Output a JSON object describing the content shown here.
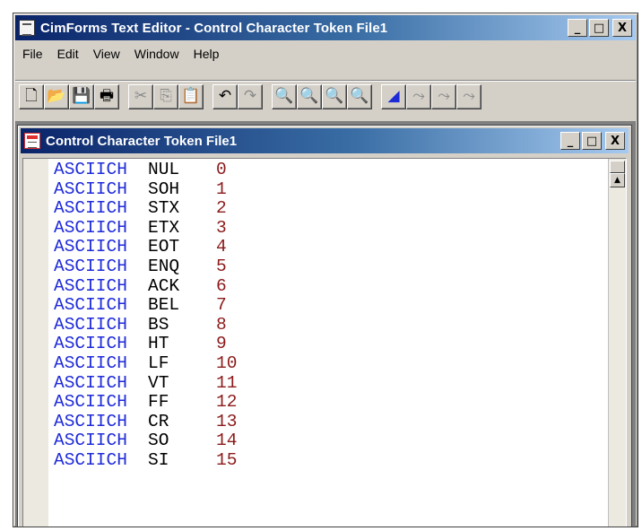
{
  "app": {
    "title": "CimForms Text Editor - Control Character Token File1",
    "window_buttons": {
      "minimize": "_",
      "maximize": "□",
      "close": "X"
    }
  },
  "menu": [
    "File",
    "Edit",
    "View",
    "Window",
    "Help"
  ],
  "toolbar": {
    "groups": [
      [
        {
          "name": "new-file-icon",
          "glyph": "🗋",
          "state": "enabled"
        },
        {
          "name": "open-folder-icon",
          "glyph": "📂",
          "state": "enabled"
        },
        {
          "name": "save-icon",
          "glyph": "💾",
          "state": "enabled"
        },
        {
          "name": "print-icon",
          "glyph": "🖶",
          "state": "enabled"
        }
      ],
      [
        {
          "name": "cut-icon",
          "glyph": "✂",
          "state": "disabled"
        },
        {
          "name": "copy-icon",
          "glyph": "⎘",
          "state": "disabled"
        },
        {
          "name": "paste-icon",
          "glyph": "📋",
          "state": "enabled"
        }
      ],
      [
        {
          "name": "undo-icon",
          "glyph": "↶",
          "state": "enabled"
        },
        {
          "name": "redo-icon",
          "glyph": "↷",
          "state": "disabled"
        }
      ],
      [
        {
          "name": "find-icon",
          "glyph": "🔍",
          "state": "enabled"
        },
        {
          "name": "find-next-icon",
          "glyph": "🔍",
          "state": "disabled"
        },
        {
          "name": "find-previous-icon",
          "glyph": "🔍",
          "state": "disabled"
        },
        {
          "name": "replace-icon",
          "glyph": "🔍",
          "state": "red"
        }
      ],
      [
        {
          "name": "bookmark-toggle-icon",
          "glyph": "◢",
          "state": "blue"
        },
        {
          "name": "bookmark-next-icon",
          "glyph": "⤳",
          "state": "disabled"
        },
        {
          "name": "bookmark-previous-icon",
          "glyph": "⤳",
          "state": "disabled"
        },
        {
          "name": "bookmark-clear-icon",
          "glyph": "⤳",
          "state": "disabled"
        }
      ]
    ]
  },
  "document": {
    "title": "Control Character Token File1",
    "lines": [
      {
        "keyword": "ASCIICH",
        "name": "NUL",
        "code": "0"
      },
      {
        "keyword": "ASCIICH",
        "name": "SOH",
        "code": "1"
      },
      {
        "keyword": "ASCIICH",
        "name": "STX",
        "code": "2"
      },
      {
        "keyword": "ASCIICH",
        "name": "ETX",
        "code": "3"
      },
      {
        "keyword": "ASCIICH",
        "name": "EOT",
        "code": "4"
      },
      {
        "keyword": "ASCIICH",
        "name": "ENQ",
        "code": "5"
      },
      {
        "keyword": "ASCIICH",
        "name": "ACK",
        "code": "6"
      },
      {
        "keyword": "ASCIICH",
        "name": "BEL",
        "code": "7"
      },
      {
        "keyword": "ASCIICH",
        "name": "BS",
        "code": "8"
      },
      {
        "keyword": "ASCIICH",
        "name": "HT",
        "code": "9"
      },
      {
        "keyword": "ASCIICH",
        "name": "LF",
        "code": "10"
      },
      {
        "keyword": "ASCIICH",
        "name": "VT",
        "code": "11"
      },
      {
        "keyword": "ASCIICH",
        "name": "FF",
        "code": "12"
      },
      {
        "keyword": "ASCIICH",
        "name": "CR",
        "code": "13"
      },
      {
        "keyword": "ASCIICH",
        "name": "SO",
        "code": "14"
      },
      {
        "keyword": "ASCIICH",
        "name": "SI",
        "code": "15"
      }
    ]
  },
  "colors": {
    "titlebar_start": "#0a246a",
    "titlebar_end": "#a6caf0",
    "keyword": "#1f2bd9",
    "name": "#000000",
    "code": "#8b1a1a",
    "chrome": "#d4d0c8"
  }
}
